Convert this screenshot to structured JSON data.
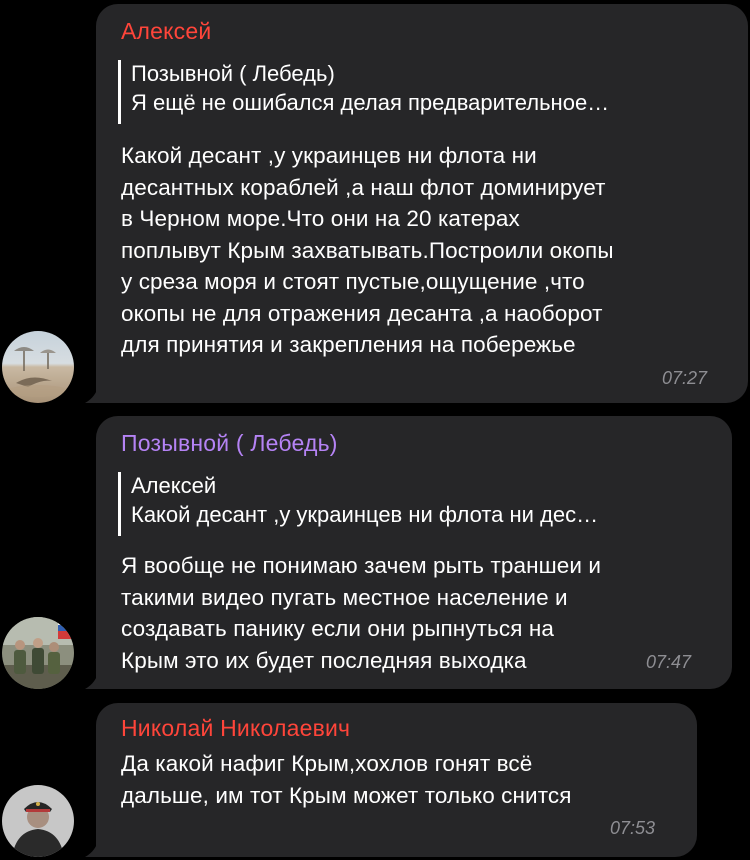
{
  "messages": [
    {
      "sender": "Алексей",
      "sender_color": "#ff453a",
      "reply": {
        "name": "Позывной ( Лебедь)",
        "text": "Я ещё не ошибался делая предварительное…"
      },
      "text": "Какой десант ,у украинцев ни флота ни\nдесантных кораблей ,а  наш флот доминирует\nв Черном море.Что они на 20 катерах\nпоплывут Крым захватывать.Построили окопы\nу среза моря и стоят пустые,ощущение ,что\nокопы не для отражения десанта ,а наоборот\nдля принятия и закрепления на побережье",
      "time": "07:27",
      "avatar": "beach-avatar"
    },
    {
      "sender": "Позывной ( Лебедь)",
      "sender_color": "#b583f5",
      "reply": {
        "name": "Алексей",
        "text": "Какой десант ,у украинцев ни флота ни дес…"
      },
      "text": "Я вообще не понимаю зачем рыть траншеи и\nтакими видео пугать местное население и\nсоздавать панику если они рыпнуться на\nКрым это их будет последняя выходка",
      "time": "07:47",
      "avatar": "soldiers-avatar"
    },
    {
      "sender": "Николай Николаевич",
      "sender_color": "#ff453a",
      "text": "Да какой нафиг Крым,хохлов гонят всё\nдальше, им тот Крым может только снится",
      "time": "07:53",
      "avatar": "officer-avatar"
    }
  ]
}
